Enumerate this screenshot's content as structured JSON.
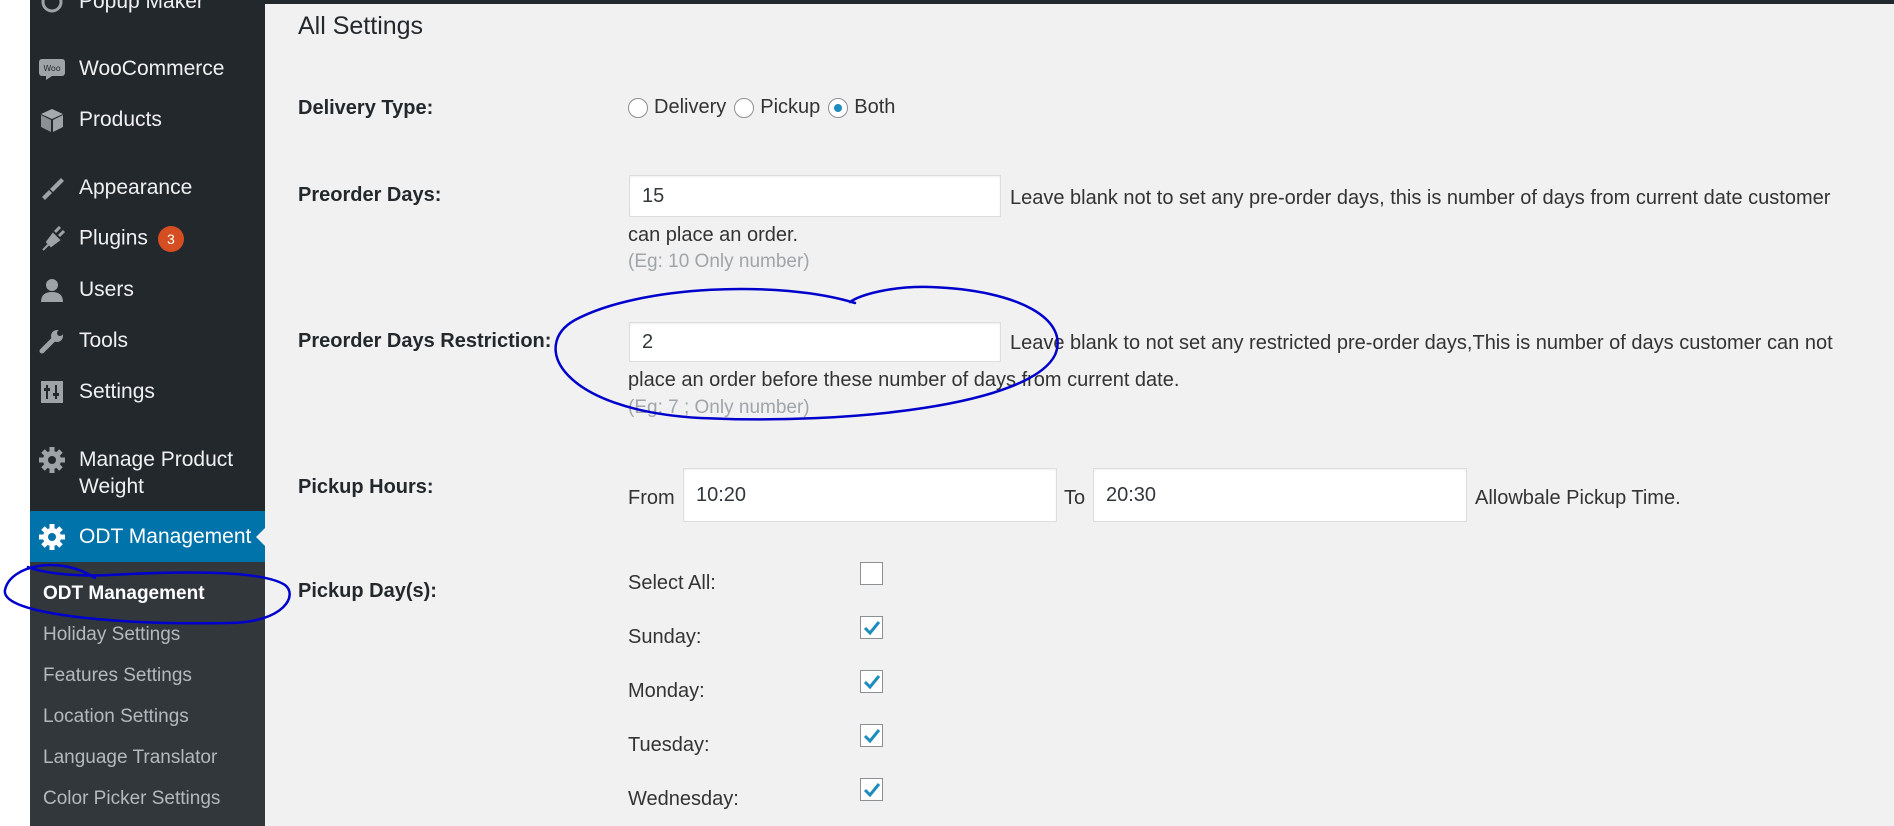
{
  "sidebar": {
    "items": [
      {
        "label": "Popup Maker",
        "icon": "popup-icon"
      },
      {
        "label": "WooCommerce",
        "icon": "woo-icon"
      },
      {
        "label": "Products",
        "icon": "box-icon"
      },
      {
        "label": "Appearance",
        "icon": "brush-icon"
      },
      {
        "label": "Plugins",
        "icon": "plugin-icon",
        "badge": "3"
      },
      {
        "label": "Users",
        "icon": "user-icon"
      },
      {
        "label": "Tools",
        "icon": "wrench-icon"
      },
      {
        "label": "Settings",
        "icon": "settings-icon"
      },
      {
        "label": "Manage Product Weight",
        "icon": "gear-icon"
      },
      {
        "label": "ODT Management",
        "icon": "gear-icon"
      }
    ],
    "submenu": [
      "ODT Management",
      "Holiday Settings",
      "Features Settings",
      "Location Settings",
      "Language Translator",
      "Color Picker Settings"
    ]
  },
  "main": {
    "title": "All Settings",
    "delivery_type": {
      "label": "Delivery Type:",
      "options": [
        "Delivery",
        "Pickup",
        "Both"
      ],
      "selected": "Both"
    },
    "preorder_days": {
      "label": "Preorder Days:",
      "value": "15",
      "description_line1": "Leave blank not to set any pre-order days, this is number of days from current date customer",
      "description_line2": "can place an order.",
      "hint": "(Eg: 10 Only number)"
    },
    "preorder_restriction": {
      "label": "Preorder Days Restriction:",
      "value": "2",
      "description_line1": "Leave blank to not set any restricted pre-order days,This is number of days customer can not",
      "description_line2": "place an order before these number of days from current date.",
      "hint": "(Eg: 7 ; Only number)"
    },
    "pickup_hours": {
      "label": "Pickup Hours:",
      "from_label": "From",
      "from_value": "10:20",
      "to_label": "To",
      "to_value": "20:30",
      "note": "Allowbale Pickup Time."
    },
    "pickup_days": {
      "label": "Pickup Day(s):",
      "select_all": "Select All:",
      "select_all_checked": false,
      "days": [
        {
          "name": "Sunday:",
          "checked": true
        },
        {
          "name": "Monday:",
          "checked": true
        },
        {
          "name": "Tuesday:",
          "checked": true
        },
        {
          "name": "Wednesday:",
          "checked": true
        }
      ]
    }
  },
  "colors": {
    "sidebar_bg": "#23282d",
    "submenu_bg": "#32373c",
    "active_bg": "#0073aa",
    "badge": "#d54e21",
    "check": "#1e8cbe",
    "annotation": "#0000cc"
  }
}
